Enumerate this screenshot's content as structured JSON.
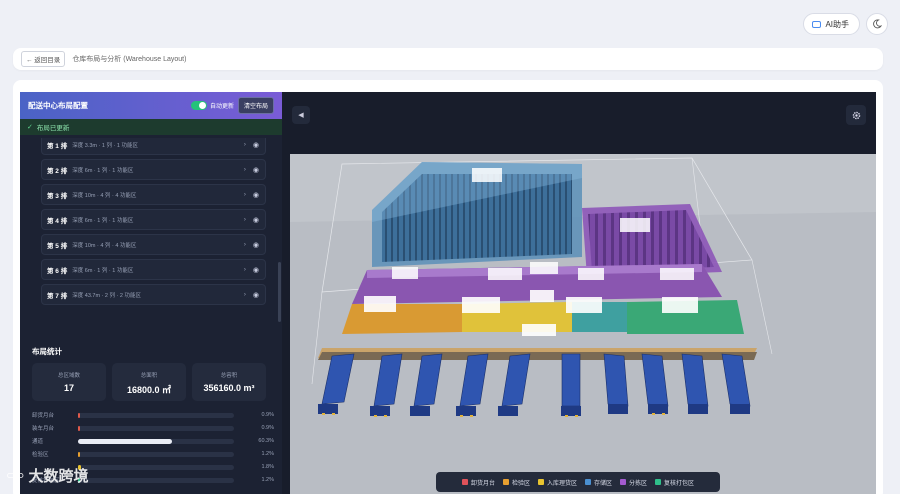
{
  "header": {
    "ai_label": "AI助手",
    "back_label": "← 返回目录",
    "breadcrumb": "仓库布局与分析 (Warehouse Layout)"
  },
  "panel": {
    "title": "配送中心布局配置",
    "auto_update_label": "自动更新",
    "clear_label": "清空布局",
    "updated_text": "布局已更新",
    "rows": [
      {
        "name": "第 1 排",
        "detail": "深度 3.3m · 1 列 · 1 功能区"
      },
      {
        "name": "第 2 排",
        "detail": "深度 6m · 1 列 · 1 功能区"
      },
      {
        "name": "第 3 排",
        "detail": "深度 10m · 4 列 · 4 功能区"
      },
      {
        "name": "第 4 排",
        "detail": "深度 6m · 1 列 · 1 功能区"
      },
      {
        "name": "第 5 排",
        "detail": "深度 10m · 4 列 · 4 功能区"
      },
      {
        "name": "第 6 排",
        "detail": "深度 6m · 1 列 · 1 功能区"
      },
      {
        "name": "第 7 排",
        "detail": "深度 43.7m · 2 列 · 2 功能区"
      }
    ],
    "stats_title": "布局统计",
    "stats": [
      {
        "label": "总区域数",
        "value": "17"
      },
      {
        "label": "总面积",
        "value": "16800.0 ㎡"
      },
      {
        "label": "总容积",
        "value": "356160.0 m³"
      }
    ],
    "bars": [
      {
        "label": "卸货月台",
        "pct": "0.9%",
        "value": 0.9,
        "color": "#e05a4b"
      },
      {
        "label": "装车月台",
        "pct": "0.9%",
        "value": 0.9,
        "color": "#e05a4b"
      },
      {
        "label": "通道",
        "pct": "60.3%",
        "value": 60.3,
        "color": "#e9ecf4"
      },
      {
        "label": "检验区",
        "pct": "1.2%",
        "value": 1.2,
        "color": "#e8a030"
      },
      {
        "label": "",
        "pct": "1.8%",
        "value": 1.8,
        "color": "#e8c430"
      },
      {
        "label": "复核打包区",
        "pct": "1.2%",
        "value": 1.2,
        "color": "#2fbf8a"
      }
    ]
  },
  "legend": [
    {
      "label": "卸货月台",
      "color": "#e0525a"
    },
    {
      "label": "检验区",
      "color": "#e8a030"
    },
    {
      "label": "入库理货区",
      "color": "#e8c430"
    },
    {
      "label": "存储区",
      "color": "#4a8fd0"
    },
    {
      "label": "分拣区",
      "color": "#a35ad0"
    },
    {
      "label": "复核打包区",
      "color": "#2fbf8a"
    }
  ],
  "scene_labels": {
    "storage": "存储区",
    "sorting": "分拣区",
    "inspection": "检验区",
    "inbound": "入库理货区",
    "packing": "复核打包区"
  },
  "watermark": "大数跨境"
}
